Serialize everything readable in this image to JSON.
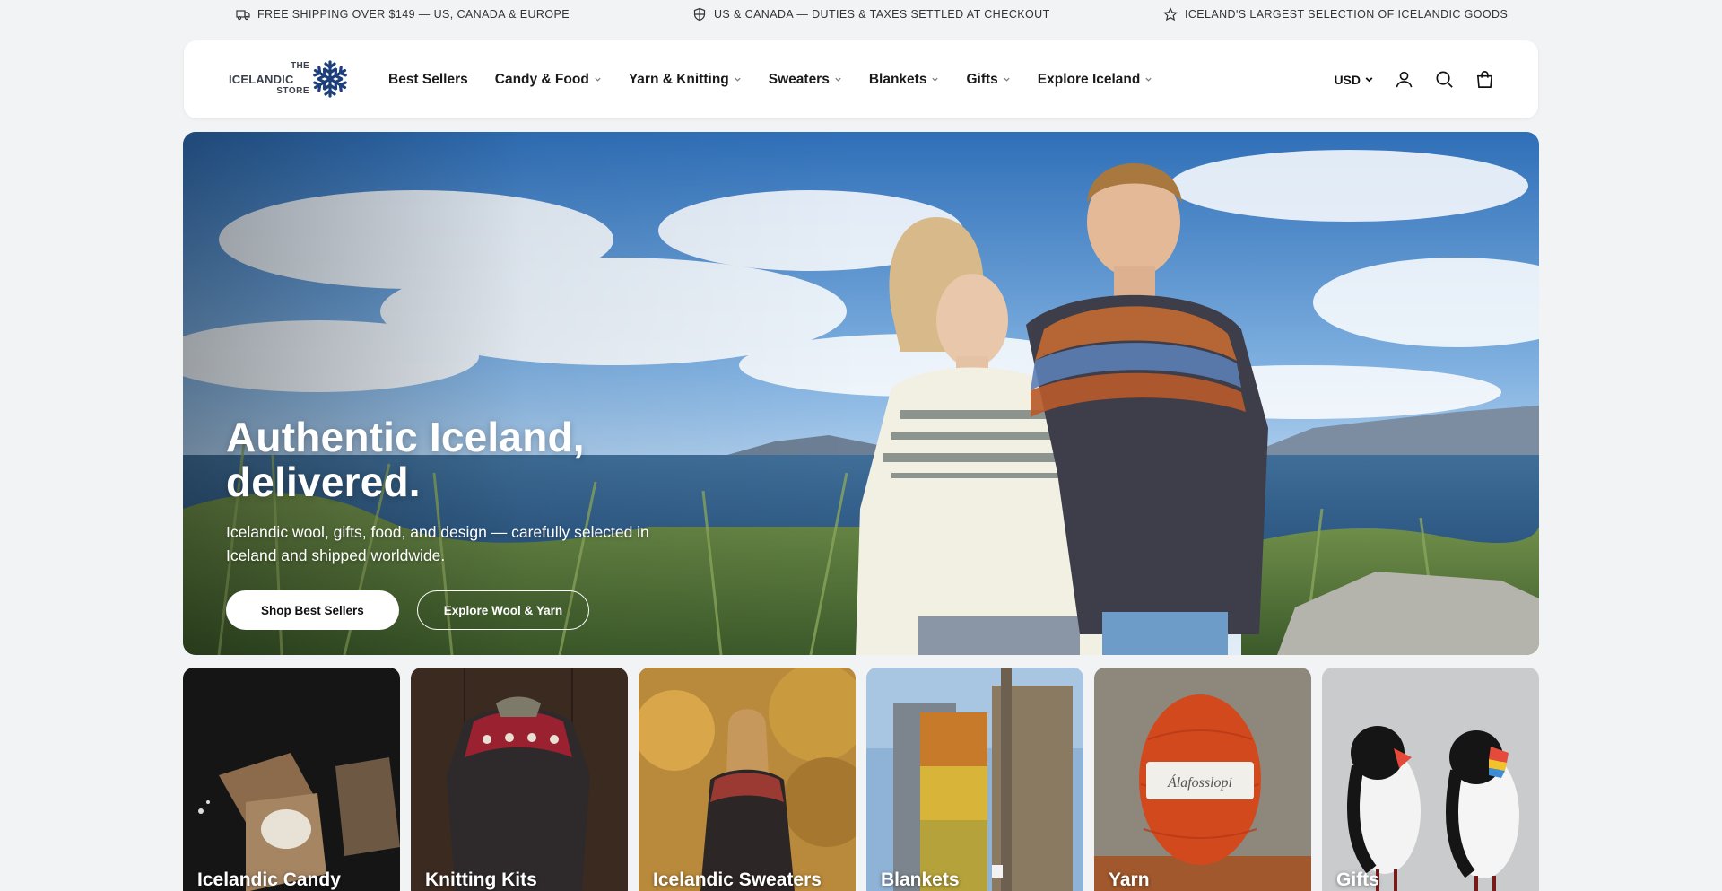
{
  "announcements": [
    {
      "icon": "truck-icon",
      "text": "FREE SHIPPING OVER $149 — US, CANADA & EUROPE"
    },
    {
      "icon": "shield-icon",
      "text": "US & CANADA — DUTIES & TAXES SETTLED AT CHECKOUT"
    },
    {
      "icon": "star-icon",
      "text": "ICELAND'S LARGEST SELECTION OF ICELANDIC GOODS"
    }
  ],
  "header": {
    "logo": {
      "line1": "THE",
      "line2": "ICELANDIC",
      "line3": "STORE",
      "icon": "snowflake-icon"
    },
    "nav": [
      {
        "label": "Best Sellers",
        "has_dropdown": false
      },
      {
        "label": "Candy & Food",
        "has_dropdown": true
      },
      {
        "label": "Yarn & Knitting",
        "has_dropdown": true
      },
      {
        "label": "Sweaters",
        "has_dropdown": true
      },
      {
        "label": "Blankets",
        "has_dropdown": true
      },
      {
        "label": "Gifts",
        "has_dropdown": true
      },
      {
        "label": "Explore Iceland",
        "has_dropdown": true
      }
    ],
    "currency": "USD",
    "icons": [
      "account-icon",
      "search-icon",
      "cart-bag-icon"
    ]
  },
  "hero": {
    "title_line1": "Authentic Iceland,",
    "title_line2": "delivered.",
    "subtitle": "Icelandic wool, gifts, food, and design — carefully selected in Iceland and shipped worldwide.",
    "primary_button": "Shop Best Sellers",
    "secondary_button": "Explore Wool & Yarn"
  },
  "categories": [
    {
      "label": "Icelandic Candy"
    },
    {
      "label": "Knitting Kits"
    },
    {
      "label": "Icelandic Sweaters"
    },
    {
      "label": "Blankets"
    },
    {
      "label": "Yarn",
      "yarn_brand": "Álafosslopi"
    },
    {
      "label": "Gifts"
    }
  ],
  "colors": {
    "page_bg": "#f2f3f4",
    "header_bg": "#ffffff",
    "text": "#111111",
    "logo_blue": "#1d3f7a"
  }
}
